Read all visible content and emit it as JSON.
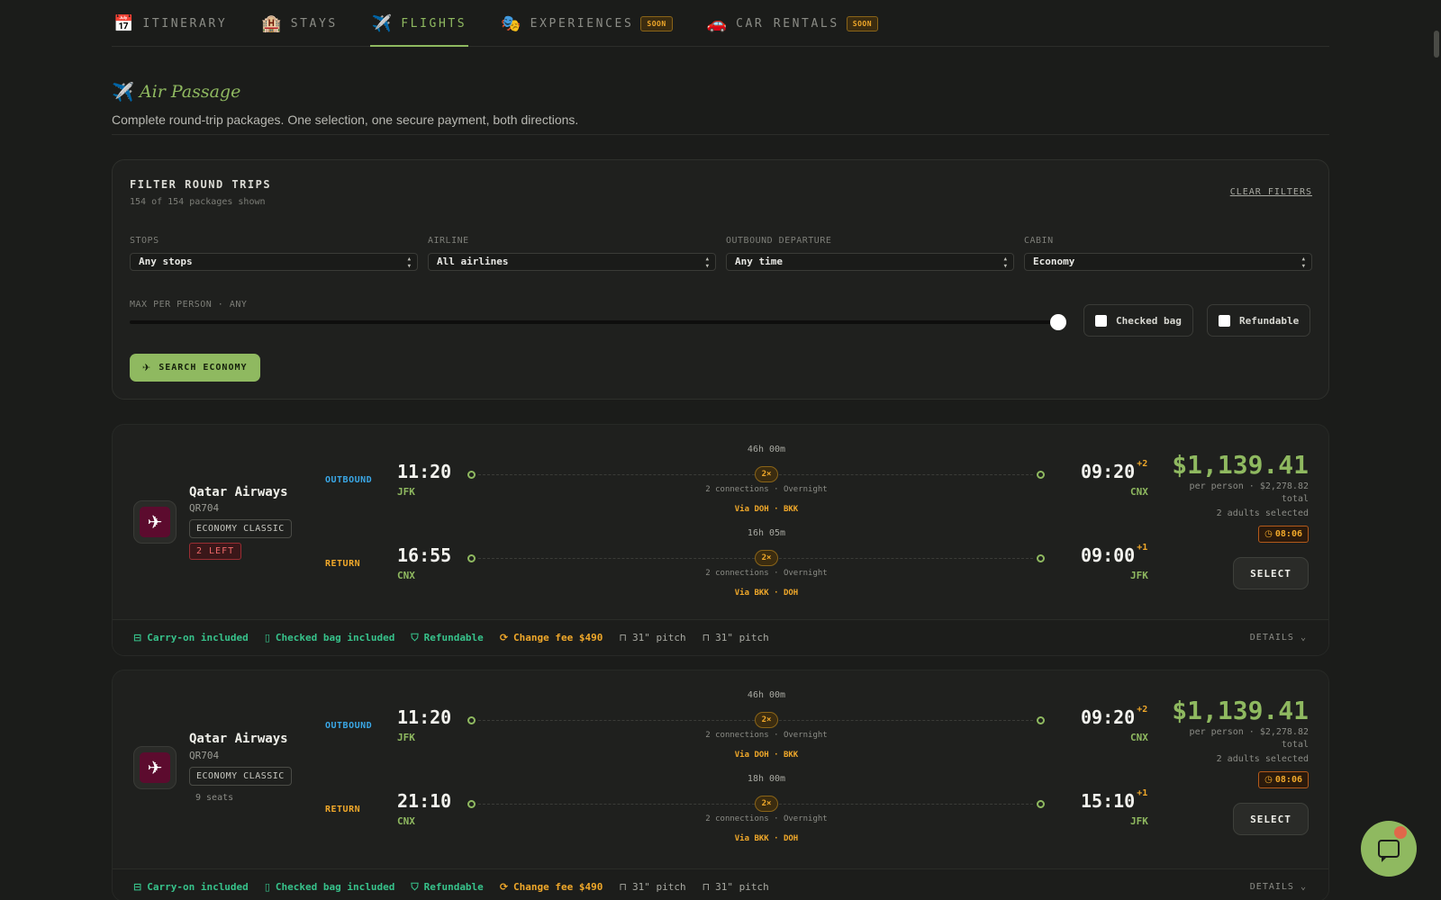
{
  "nav": {
    "tabs": [
      {
        "icon": "calendar-icon",
        "emoji": "📅",
        "label": "ITINERARY",
        "active": false,
        "soon": false
      },
      {
        "icon": "hotel-icon",
        "emoji": "🏨",
        "label": "STAYS",
        "active": false,
        "soon": false
      },
      {
        "icon": "airplane-icon",
        "emoji": "✈️",
        "label": "FLIGHTS",
        "active": true,
        "soon": false
      },
      {
        "icon": "masks-icon",
        "emoji": "🎭",
        "label": "EXPERIENCES",
        "active": false,
        "soon": true
      },
      {
        "icon": "car-icon",
        "emoji": "🚗",
        "label": "CAR RENTALS",
        "active": false,
        "soon": true
      }
    ],
    "soon_label": "SOON"
  },
  "section": {
    "emoji": "✈️",
    "title": "Air Passage",
    "subtitle": "Complete round-trip packages. One selection, one secure payment, both directions."
  },
  "filters": {
    "title": "FILTER ROUND TRIPS",
    "count": "154 of 154 packages shown",
    "clear": "CLEAR FILTERS",
    "stops": {
      "label": "STOPS",
      "value": "Any stops"
    },
    "airline": {
      "label": "AIRLINE",
      "value": "All airlines"
    },
    "departure": {
      "label": "OUTBOUND DEPARTURE",
      "value": "Any time"
    },
    "cabin": {
      "label": "CABIN",
      "value": "Economy"
    },
    "max_price_label": "MAX PER PERSON · ANY",
    "max_price_fraction": 1.0,
    "checked_bag": "Checked bag",
    "refundable": "Refundable",
    "search_button": "SEARCH ECONOMY"
  },
  "cards": [
    {
      "airline": "Qatar Airways",
      "flight_no": "QR704",
      "cabin": "ECONOMY CLASSIC",
      "availability": "2 LEFT",
      "availability_type": "urgent",
      "outbound": {
        "label": "OUTBOUND",
        "dep_time": "11:20",
        "dep_code": "JFK",
        "arr_time": "09:20",
        "arr_offset": "+2",
        "arr_code": "CNX",
        "duration": "46h 00m",
        "stops": "2×",
        "connections": "2 connections · Overnight",
        "via": "Via DOH · BKK"
      },
      "return": {
        "label": "RETURN",
        "dep_time": "16:55",
        "dep_code": "CNX",
        "arr_time": "09:00",
        "arr_offset": "+1",
        "arr_code": "JFK",
        "duration": "16h 05m",
        "stops": "2×",
        "connections": "2 connections · Overnight",
        "via": "Via BKK · DOH"
      },
      "price": "$1,139.41",
      "per_person": "per person · $2,278.82 total",
      "adults": "2 adults selected",
      "timer": "08:06",
      "select": "SELECT",
      "features": {
        "carry_on": "Carry-on included",
        "checked": "Checked bag included",
        "refundable": "Refundable",
        "change_fee": "Change fee $490",
        "pitch_out": "31\" pitch",
        "pitch_ret": "31\" pitch"
      },
      "details": "DETAILS"
    },
    {
      "airline": "Qatar Airways",
      "flight_no": "QR704",
      "cabin": "ECONOMY CLASSIC",
      "availability": "9 seats",
      "availability_type": "normal",
      "outbound": {
        "label": "OUTBOUND",
        "dep_time": "11:20",
        "dep_code": "JFK",
        "arr_time": "09:20",
        "arr_offset": "+2",
        "arr_code": "CNX",
        "duration": "46h 00m",
        "stops": "2×",
        "connections": "2 connections · Overnight",
        "via": "Via DOH · BKK"
      },
      "return": {
        "label": "RETURN",
        "dep_time": "21:10",
        "dep_code": "CNX",
        "arr_time": "15:10",
        "arr_offset": "+1",
        "arr_code": "JFK",
        "duration": "18h 00m",
        "stops": "2×",
        "connections": "2 connections · Overnight",
        "via": "Via BKK · DOH"
      },
      "price": "$1,139.41",
      "per_person": "per person · $2,278.82 total",
      "adults": "2 adults selected",
      "timer": "08:06",
      "select": "SELECT",
      "features": {
        "carry_on": "Carry-on included",
        "checked": "Checked bag included",
        "refundable": "Refundable",
        "change_fee": "Change fee $490",
        "pitch_out": "31\" pitch",
        "pitch_ret": "31\" pitch"
      },
      "details": "DETAILS"
    }
  ],
  "colors": {
    "accent": "#8fb960",
    "outbound": "#3aa7e6",
    "return": "#f0a82a",
    "feature_green": "#37c28b",
    "background": "#1b1c1a"
  }
}
